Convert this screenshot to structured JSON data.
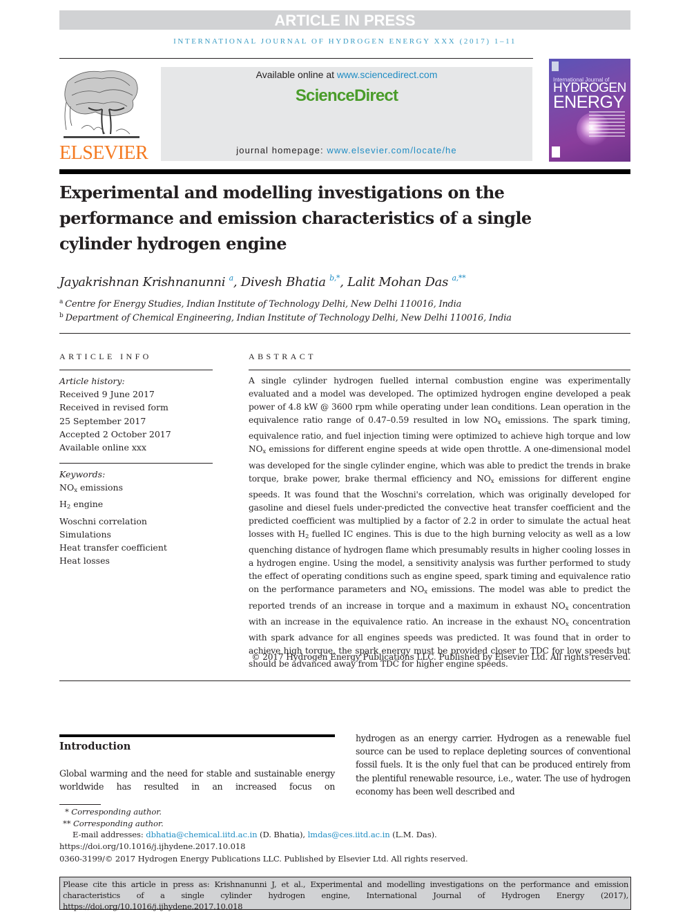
{
  "banner": {
    "label": "ARTICLE IN PRESS"
  },
  "journal_running_head": "INTERNATIONAL JOURNAL OF HYDROGEN ENERGY XXX (2017) 1–11",
  "publisher": {
    "name": "ELSEVIER",
    "logo_icon": "elsevier-tree-icon"
  },
  "sciencedirect": {
    "available_prefix": "Available online at ",
    "available_link": "www.sciencedirect.com",
    "logo": "ScienceDirect",
    "homepage_prefix": "journal homepage: ",
    "homepage_link": "www.elsevier.com/locate/he"
  },
  "cover": {
    "line1": "International Journal of",
    "line2": "HYDROGEN",
    "line3": "ENERGY"
  },
  "article": {
    "title": "Experimental and modelling investigations on the performance and emission characteristics of a single cylinder hydrogen engine",
    "authors": [
      {
        "name": "Jayakrishnan Krishnanunni",
        "sup": "a"
      },
      {
        "name": "Divesh Bhatia",
        "sup": "b,*"
      },
      {
        "name": "Lalit Mohan Das",
        "sup": "a,**"
      }
    ],
    "affiliations": [
      {
        "mark": "a",
        "text": "Centre for Energy Studies, Indian Institute of Technology Delhi, New Delhi 110016, India"
      },
      {
        "mark": "b",
        "text": "Department of Chemical Engineering, Indian Institute of Technology Delhi, New Delhi 110016, India"
      }
    ]
  },
  "article_info": {
    "heading": "ARTICLE INFO",
    "history_label": "Article history:",
    "history": [
      "Received 9 June 2017",
      "Received in revised form",
      "25 September 2017",
      "Accepted 2 October 2017",
      "Available online xxx"
    ],
    "keywords_label": "Keywords:",
    "keywords": [
      {
        "main": "NO",
        "sub": "x",
        "rest": " emissions"
      },
      {
        "main": "H",
        "sub": "2",
        "rest": " engine"
      },
      {
        "main": "Woschni correlation",
        "sub": "",
        "rest": ""
      },
      {
        "main": "Simulations",
        "sub": "",
        "rest": ""
      },
      {
        "main": "Heat transfer coefficient",
        "sub": "",
        "rest": ""
      },
      {
        "main": "Heat losses",
        "sub": "",
        "rest": ""
      }
    ]
  },
  "abstract": {
    "heading": "ABSTRACT",
    "segments": [
      {
        "t": "A single cylinder hydrogen fuelled internal combustion engine was experimentally evaluated and a model was developed. The optimized hydrogen engine developed a peak power of 4.8 kW @ 3600 rpm while operating under lean conditions. Lean operation in the equivalence ratio range of 0.47–0.59 resulted in low NO"
      },
      {
        "sub": "x"
      },
      {
        "t": " emissions. The spark timing, equivalence ratio, and fuel injection timing were optimized to achieve high torque and low NO"
      },
      {
        "sub": "x"
      },
      {
        "t": " emissions for different engine speeds at wide open throttle. A one-dimensional model was developed for the single cylinder engine, which was able to predict the trends in brake torque, brake power, brake thermal efficiency and NO"
      },
      {
        "sub": "x"
      },
      {
        "t": " emissions for different engine speeds. It was found that the Woschni's correlation, which was originally developed for gasoline and diesel fuels under-predicted the convective heat transfer coefficient and the predicted coefficient was multiplied by a factor of 2.2 in order to simulate the actual heat losses with H"
      },
      {
        "sub": "2"
      },
      {
        "t": " fuelled IC engines. This is due to the high burning velocity as well as a low quenching distance of hydrogen flame which presumably results in higher cooling losses in a hydrogen engine. Using the model, a sensitivity analysis was further performed to study the effect of operating conditions such as engine speed, spark timing and equivalence ratio on the performance parameters and NO"
      },
      {
        "sub": "x"
      },
      {
        "t": " emissions. The model was able to predict the reported trends of an increase in torque and a maximum in exhaust NO"
      },
      {
        "sub": "x"
      },
      {
        "t": " concentration with an increase in the equivalence ratio. An increase in the exhaust NO"
      },
      {
        "sub": "x"
      },
      {
        "t": " concentration with spark advance for all engines speeds was predicted. It was found that in order to achieve high torque, the spark energy must be provided closer to TDC for low speeds but should be advanced away from TDC for higher engine speeds."
      }
    ],
    "copyright": "© 2017 Hydrogen Energy Publications LLC. Published by Elsevier Ltd. All rights reserved."
  },
  "introduction": {
    "heading": "Introduction",
    "left_text": "Global warming and the need for stable and sustainable energy worldwide has resulted in an increased focus on",
    "right_text": "hydrogen as an energy carrier. Hydrogen as a renewable fuel source can be used to replace depleting sources of conventional fossil fuels. It is the only fuel that can be produced entirely from the plentiful renewable resource, i.e., water. The use of hydrogen economy has been well described and"
  },
  "footnotes": {
    "star1_mark": "*",
    "star1_text": "Corresponding author.",
    "star2_mark": "**",
    "star2_text": "Corresponding author.",
    "email_label": "E-mail addresses: ",
    "email1": "dbhatia@chemical.iitd.ac.in",
    "email1_owner": " (D. Bhatia), ",
    "email2": "lmdas@ces.iitd.ac.in",
    "email2_owner": " (L.M. Das).",
    "doi": "https://doi.org/10.1016/j.ijhydene.2017.10.018",
    "issn_line": "0360-3199/© 2017 Hydrogen Energy Publications LLC. Published by Elsevier Ltd. All rights reserved."
  },
  "citation_box": "Please cite this article in press as: Krishnanunni J, et al., Experimental and modelling investigations on the performance and emission characteristics of a single cylinder hydrogen engine, International Journal of Hydrogen Energy (2017), https://doi.org/10.1016/j.ijhydene.2017.10.018"
}
